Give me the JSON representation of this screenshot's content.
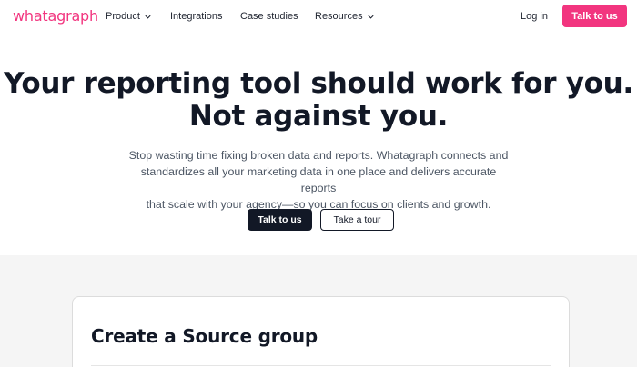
{
  "header": {
    "logo": "whatagraph",
    "nav": {
      "product": "Product",
      "integrations": "Integrations",
      "case_studies": "Case studies",
      "resources": "Resources"
    },
    "login": "Log in",
    "cta": "Talk to us"
  },
  "hero": {
    "title_line1": "Your reporting tool should work for you.",
    "title_line2": "Not against you.",
    "subtitle_line1": "Stop wasting time fixing broken data and reports. Whatagraph connects and",
    "subtitle_line2": "standardizes all your marketing data in one place and delivers accurate reports",
    "subtitle_line3": "that scale with your agency—so you can focus on clients and growth.",
    "primary_button": "Talk to us",
    "secondary_button": "Take a tour"
  },
  "card": {
    "title": "Create a Source group"
  },
  "colors": {
    "brand": "#f2357f",
    "dark": "#121826",
    "section_bg": "#f5f5f5"
  }
}
